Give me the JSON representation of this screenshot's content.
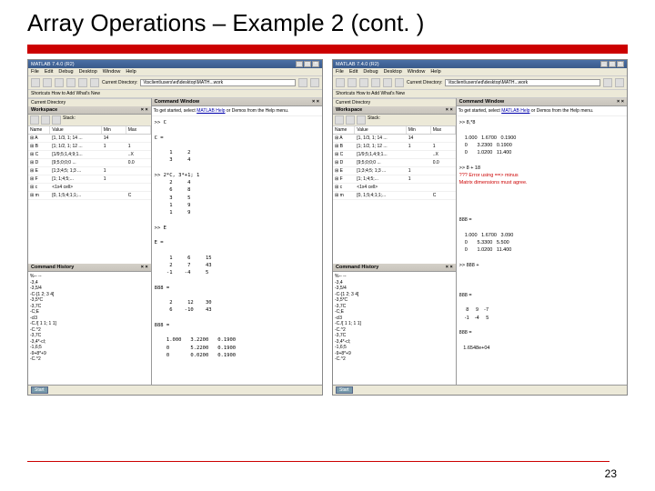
{
  "slide": {
    "title": "Array Operations – Example 2 (cont. )",
    "page": "23"
  },
  "matlab": {
    "title": "MATLAB 7.4.0 (R2)",
    "menu": [
      "File",
      "Edit",
      "Debug",
      "Desktop",
      "Window",
      "Help"
    ],
    "curdir_label": "Current Directory:",
    "curdir_val": "\\\\tsclient\\users\\ed\\desktop\\MATH...work",
    "shortcuts": "Shortcuts   How to Add   What's New",
    "workspace_tab": "Current Directory",
    "workspace_lbl": "Workspace",
    "ws_head": {
      "name": "Name",
      "value": "Value",
      "min": "Min",
      "max": "Max"
    },
    "vars_left": [
      {
        "n": "A",
        "v": "[1, 1/3, 1; 14 ...",
        "mn": "14",
        "mx": ""
      },
      {
        "n": "B",
        "v": "[1; 1/2, 1; 12 ...",
        "mn": "1",
        "mx": "1"
      },
      {
        "n": "C",
        "v": "[1/9;5;1,4;9;1...",
        "mn": "",
        "mx": "..X"
      },
      {
        "n": "D",
        "v": "[9;5;0;0;0 ...",
        "mn": "",
        "mx": "0.0"
      },
      {
        "n": "E",
        "v": "[1;3;4;5; 1;3 ...",
        "mn": "1",
        "mx": ""
      },
      {
        "n": "F",
        "v": "[1; 1;4;5;...",
        "mn": "1",
        "mx": ""
      },
      {
        "n": "c",
        "v": "<1x4 cell>",
        "mn": "",
        "mx": ""
      },
      {
        "n": "m",
        "v": "[0, 1;5;4;1;1;...",
        "mn": "",
        "mx": "C"
      }
    ],
    "cmdhist_lbl": "Command History",
    "cmdhist_lines": [
      "%-- --",
      "-3,4",
      "-3,5/4",
      "-C-[1 2; 3 4]",
      "-3,5*C",
      "-3,7C",
      "-C;E",
      "-cl3",
      "-C./[ 1 1; 1 1]",
      "-C.^2",
      "-3,7C",
      "-3,4*-cl;",
      "-1,6;5",
      "-9+8*+9",
      "-C.^2"
    ],
    "cmdwin_lbl": "Command Window",
    "startmsg_pre": "To get started, select ",
    "startmsg_link": "MATLAB Help",
    "startmsg_post": " or Demos from the Help menu.",
    "cmdwin_left": ">> C\n\nC =\n\n     1     2\n     3     4\n\n>> 2*C, 3*+1; 1\n     2     4\n     6     8\n     3     5\n     1     9\n     1     9\n\n>> E\n\nE =\n\n     1     6     15\n     2     7     43\n    -1    -4     5\n\n888 =\n\n     2     12    30\n     6    -10    43\n\n888 =\n\n    1.000   3.2200   0.1900\n    0       5.2200   0.1900\n    0       0.0200   0.1900",
    "cmdwin_right": ">> 8,*8\n\n    1.000   1.6700   0.1900\n    0       3.2300   0.1900\n    0       1.0200   11.400\n\n>> 8 + 18\n??? Error using ==> minus\nMatrix dimensions must agree.\n\n\n\n\n888 =\n\n    1.000   1.6700   3.090\n    0       5.3300   5.500\n    0       1.0200   11.400\n\n>> 888 +\n\n\n\n888 =\n\n     8     9    -7\n    -1    -4     5\n\n888 =\n\n   1.6548e+04\n",
    "start_btn": "Start"
  }
}
